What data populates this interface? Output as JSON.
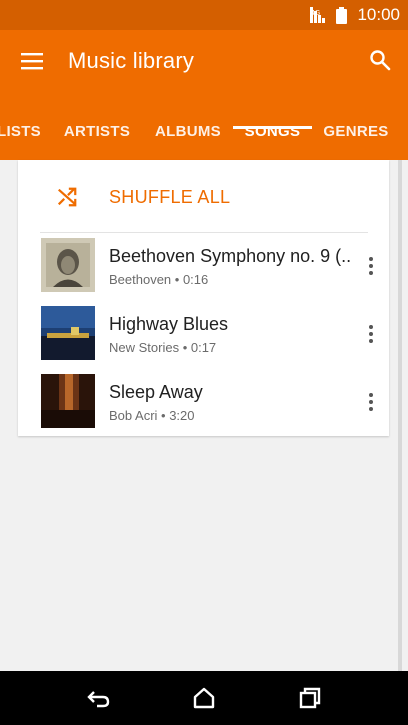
{
  "status_bar": {
    "time": "10:00",
    "signal_icon": "signal-icon",
    "battery_icon": "battery-icon"
  },
  "app_bar": {
    "title": "Music library",
    "menu_icon": "menu-icon",
    "search_icon": "search-icon",
    "color": "#ef6c00"
  },
  "tabs": [
    {
      "label": "LISTS",
      "active": false
    },
    {
      "label": "ARTISTS",
      "active": false
    },
    {
      "label": "ALBUMS",
      "active": false
    },
    {
      "label": "SONGS",
      "active": true
    },
    {
      "label": "GENRES",
      "active": false
    }
  ],
  "shuffle": {
    "label": "SHUFFLE ALL",
    "icon": "shuffle-icon"
  },
  "songs": [
    {
      "title": "Beethoven Symphony no. 9 (..",
      "subtitle": "Beethoven • 0:16"
    },
    {
      "title": "Highway Blues",
      "subtitle": "New Stories • 0:17"
    },
    {
      "title": "Sleep Away",
      "subtitle": "Bob Acri • 3:20"
    }
  ],
  "nav_bar": {
    "back_icon": "back-icon",
    "home_icon": "home-icon",
    "recents_icon": "recents-icon"
  }
}
